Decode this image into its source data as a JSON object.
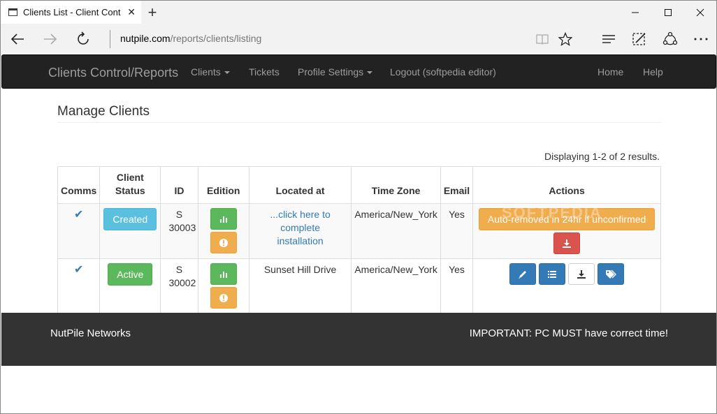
{
  "browser": {
    "tab_title": "Clients List - Client Cont",
    "url_host": "nutpile.com",
    "url_path": "/reports/clients/listing"
  },
  "site": {
    "brand": "Clients Control/Reports",
    "nav": {
      "clients": "Clients",
      "tickets": "Tickets",
      "profile": "Profile Settings",
      "logout": "Logout (softpedia editor)",
      "home": "Home",
      "help": "Help"
    }
  },
  "page": {
    "title": "Manage Clients",
    "summary": "Displaying 1-2 of 2 results."
  },
  "table": {
    "headers": {
      "comms": "Comms",
      "status": "Client Status",
      "id": "ID",
      "edition": "Edition",
      "located": "Located at",
      "timezone": "Time Zone",
      "email": "Email",
      "actions": "Actions"
    },
    "rows": [
      {
        "comms": "✔",
        "status": "Created",
        "id": "S 30003",
        "located": "...click here to complete installation",
        "timezone": "America/New_York",
        "email": "Yes",
        "action_notice": "Auto-removed in 24hr if unconfirmed"
      },
      {
        "comms": "✔",
        "status": "Active",
        "id": "S 30002",
        "located": "Sunset Hill Drive",
        "timezone": "America/New_York",
        "email": "Yes"
      }
    ]
  },
  "footer": {
    "left": "NutPile Networks",
    "right": "IMPORTANT: PC MUST have correct time!"
  },
  "watermark": "SOFTPEDIA",
  "colors": {
    "navbar": "#222222",
    "footer": "#333333",
    "info": "#5bc0de",
    "success": "#5cb85c",
    "warning": "#f0ad4e",
    "danger": "#d9534f",
    "primary": "#337ab7"
  }
}
